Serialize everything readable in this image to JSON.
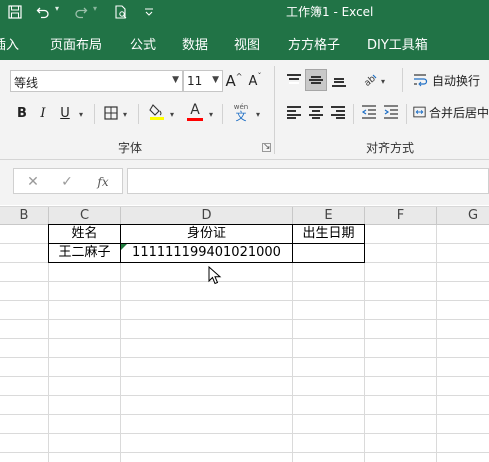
{
  "window": {
    "title": "工作簿1  -  Excel"
  },
  "tabs": [
    {
      "label": "插入",
      "display": "插入"
    },
    {
      "label": "页面布局"
    },
    {
      "label": "公式"
    },
    {
      "label": "数据"
    },
    {
      "label": "视图"
    },
    {
      "label": "方方格子"
    },
    {
      "label": "DIY工具箱"
    }
  ],
  "ribbon": {
    "font_name": "等线",
    "font_size": "11",
    "grow_font": "A",
    "shrink_font": "A",
    "bold": "B",
    "italic": "I",
    "underline": "U",
    "phonetic_top": "wén",
    "phonetic_bottom": "文",
    "font_color_letter": "A",
    "group_font_label": "字体",
    "group_align_label": "对齐方式",
    "wrap_text_label": "自动换行",
    "merge_center_label": "合并后居中",
    "fill_color": "#ffff00",
    "font_color": "#ff0000"
  },
  "formula_bar": {
    "fx_label": "fx",
    "formula": ""
  },
  "columns": [
    "B",
    "C",
    "D",
    "E",
    "F",
    "G"
  ],
  "table": {
    "headers": [
      "姓名",
      "身份证",
      "出生日期"
    ],
    "rows": [
      [
        "王二麻子",
        "111111199401021000",
        ""
      ]
    ]
  }
}
